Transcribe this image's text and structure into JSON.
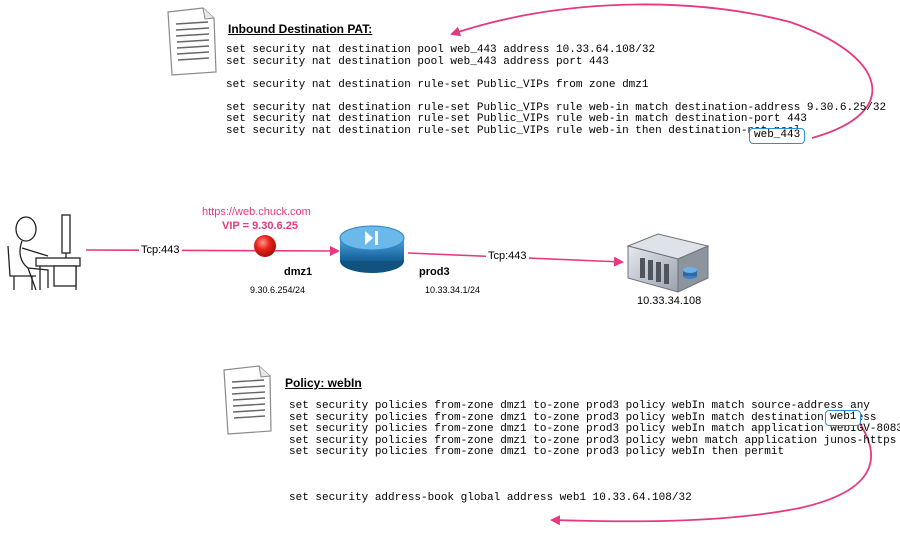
{
  "nat_section": {
    "title": "Inbound Destination PAT:",
    "lines": [
      "set security nat destination pool web_443 address 10.33.64.108/32",
      "set security nat destination pool web_443 address port 443",
      "",
      "set security nat destination rule-set Public_VIPs from zone dmz1",
      "",
      "set security nat destination rule-set Public_VIPs rule web-in match destination-address 9.30.6.25/32",
      "set security nat destination rule-set Public_VIPs rule web-in match destination-port 443",
      "set security nat destination rule-set Public_VIPs rule web-in then destination-nat pool"
    ],
    "pool_callout": "web_443"
  },
  "topology": {
    "link1_label": "Tcp:443",
    "link2_label": "Tcp:443",
    "url": "https://web.chuck.com",
    "vip": "VIP = 9.30.6.25",
    "zone_in": "dmz1",
    "zone_in_ip": "9.30.6.254/24",
    "zone_out": "prod3",
    "zone_out_ip": "10.33.34.1/24",
    "server_ip": "10.33.34.108"
  },
  "policy_section": {
    "title": "Policy: webIn",
    "lines": [
      "set security policies from-zone dmz1 to-zone prod3 policy webIn match source-address any",
      "set security policies from-zone dmz1 to-zone prod3 policy webIn match destination-address",
      "set security policies from-zone dmz1 to-zone prod3 policy webIn match application webIGV-8083",
      "set security policies from-zone dmz1 to-zone prod3 policy webn match application junos-https",
      "set security policies from-zone dmz1 to-zone prod3 policy webIn then permit"
    ],
    "address_callout": "web1",
    "address_book_line": "set security address-book global address web1 10.33.64.108/32"
  },
  "colors": {
    "accent_pink": "#e6397f",
    "callout_border": "#2a8fd9",
    "router_blue": "#1e78b4"
  }
}
